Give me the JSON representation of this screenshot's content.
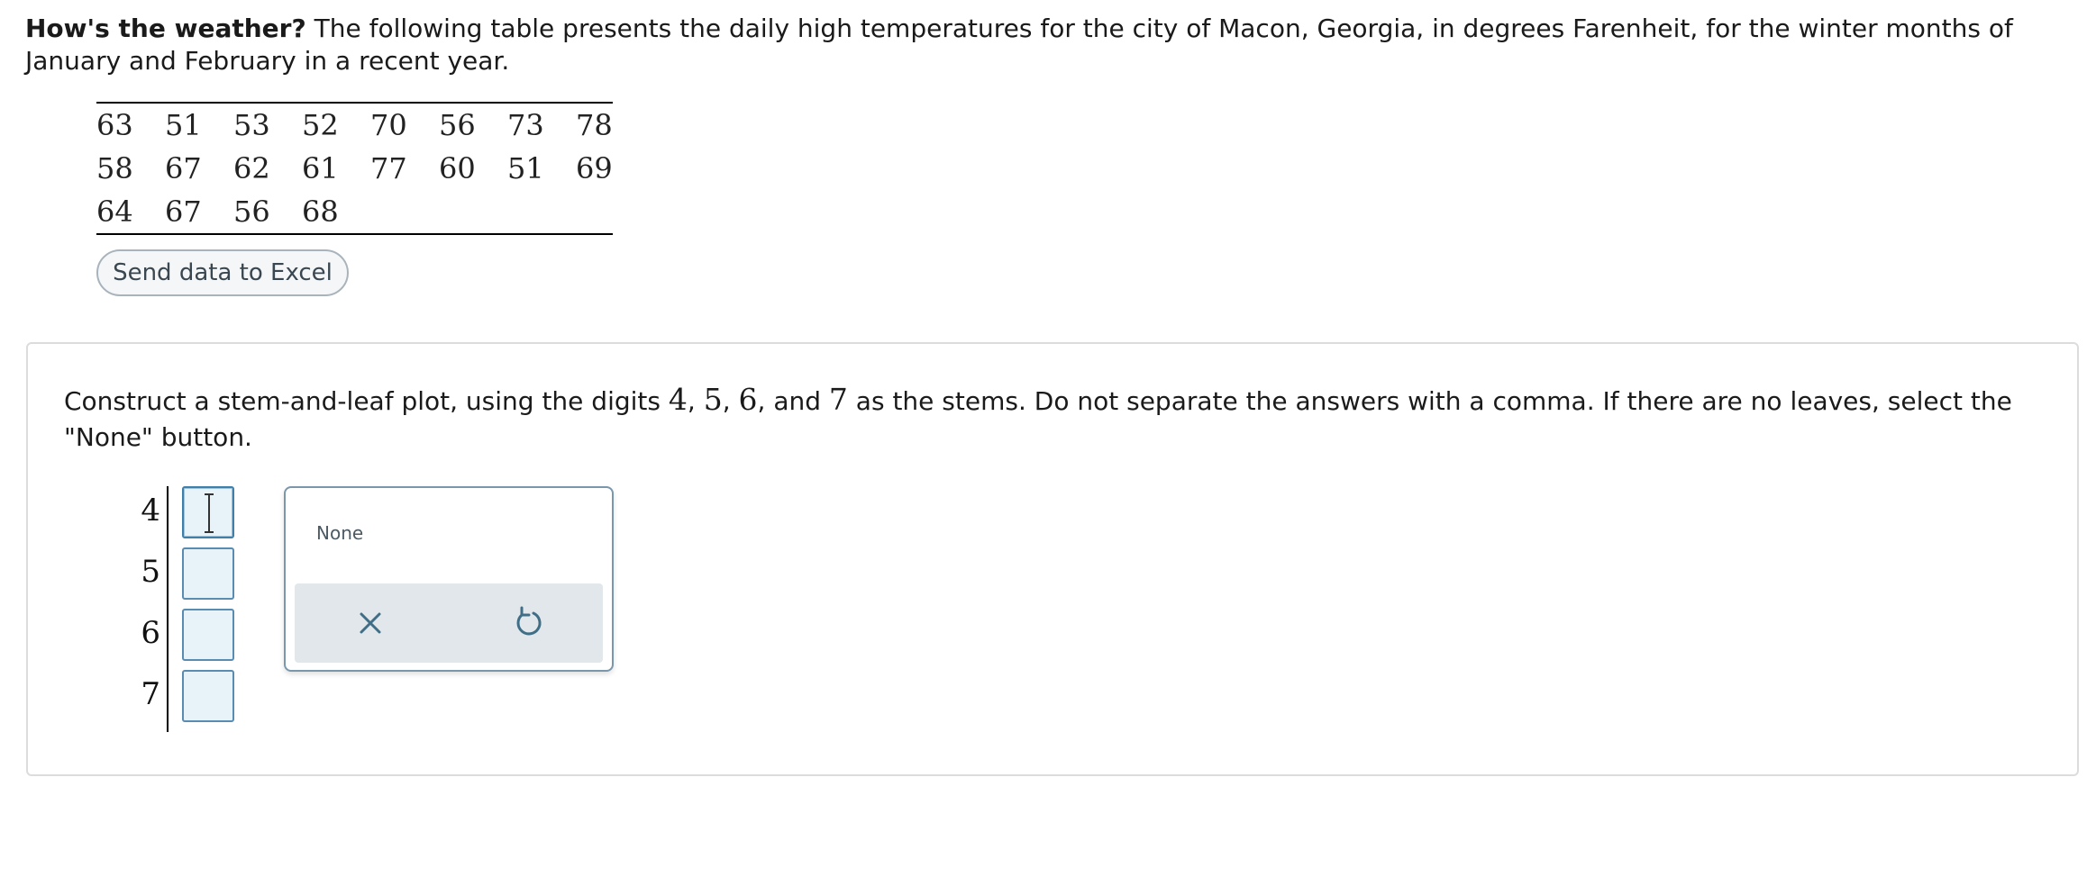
{
  "intro": {
    "lead": "How's the weather?",
    "text": " The following table presents the daily high temperatures for the city of Macon, Georgia, in degrees Farenheit, for the winter months of January and February in a recent year."
  },
  "table": {
    "rows": [
      [
        "63",
        "51",
        "53",
        "52",
        "70",
        "56",
        "73",
        "78"
      ],
      [
        "58",
        "67",
        "62",
        "61",
        "77",
        "60",
        "51",
        "69"
      ],
      [
        "64",
        "67",
        "56",
        "68",
        "",
        "",
        "",
        ""
      ]
    ]
  },
  "excel_button": {
    "label": "Send data to Excel"
  },
  "question": {
    "prompt_a": "Construct a stem-and-leaf plot, using the digits ",
    "d4": "4",
    "sep1": ", ",
    "d5": "5",
    "sep2": ", ",
    "d6": "6",
    "sep3": ", and ",
    "d7": "7",
    "prompt_b": " as the stems. Do not separate the answers with a comma. If there are no leaves, select the \"None\" button."
  },
  "stem_plot": {
    "stems": [
      "4",
      "5",
      "6",
      "7"
    ],
    "leaves": [
      "",
      "",
      "",
      ""
    ]
  },
  "answer_panel": {
    "none_label": "None",
    "clear_icon": "close-icon",
    "undo_icon": "undo-icon"
  },
  "colors": {
    "input_fill": "#e8f3f9",
    "input_border": "#5a8bb0",
    "action_bar": "#e1e7ea",
    "icon": "#3f6e86"
  }
}
